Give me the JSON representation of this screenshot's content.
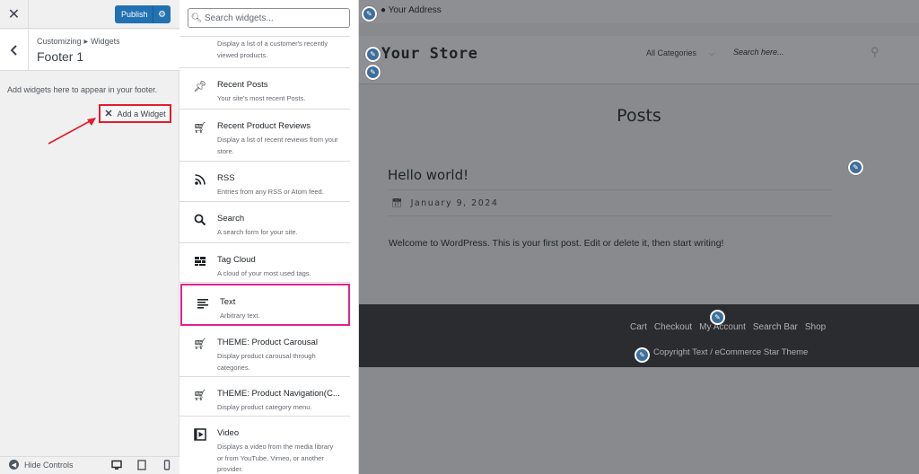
{
  "customizer": {
    "close_label": "✕",
    "publish_label": "Publish",
    "breadcrumb_parent": "Customizing",
    "breadcrumb_section": "Widgets",
    "title": "Footer 1",
    "description": "Add widgets here to appear in your footer.",
    "add_widget_label": "Add a Widget",
    "hide_controls_label": "Hide Controls",
    "accent": "#2271b1"
  },
  "widget_panel": {
    "search_placeholder": "Search widgets...",
    "partial_item_desc": "Display a list of a customer's recently viewed products.",
    "items": [
      {
        "name": "Recent Posts",
        "desc": "Your site's most recent Posts.",
        "icon": "pin-icon"
      },
      {
        "name": "Recent Product Reviews",
        "desc": "Display a list of recent reviews from your store.",
        "icon": "cart-icon"
      },
      {
        "name": "RSS",
        "desc": "Entries from any RSS or Atom feed.",
        "icon": "rss-icon"
      },
      {
        "name": "Search",
        "desc": "A search form for your site.",
        "icon": "search-icon"
      },
      {
        "name": "Tag Cloud",
        "desc": "A cloud of your most used tags.",
        "icon": "tag-cloud-icon"
      },
      {
        "name": "Text",
        "desc": "Arbitrary text.",
        "icon": "text-icon"
      },
      {
        "name": "THEME: Product Carousal",
        "desc": "Display product carousal through categories.",
        "icon": "cart-icon"
      },
      {
        "name": "THEME: Product Navigation(C...",
        "desc": "Display product category menu.",
        "icon": "cart-icon"
      },
      {
        "name": "Video",
        "desc": "Displays a video from the media library or from YouTube, Vimeo, or another provider.",
        "icon": "video-icon"
      }
    ],
    "highlight_color": "#e2238f"
  },
  "preview": {
    "address": "Your Address",
    "store_name": "Your Store",
    "categories_label": "All Categories",
    "search_placeholder": "Search here...",
    "page_heading": "Posts",
    "post_title": "Hello world!",
    "post_date": "January 9, 2024",
    "post_excerpt": "Welcome to WordPress. This is your first post. Edit or delete it, then start writing!",
    "footer_menu": [
      "Cart",
      "Checkout",
      "My Account",
      "Search Bar",
      "Shop"
    ],
    "copyright": "Copyright Text / eCommerce Star Theme"
  }
}
